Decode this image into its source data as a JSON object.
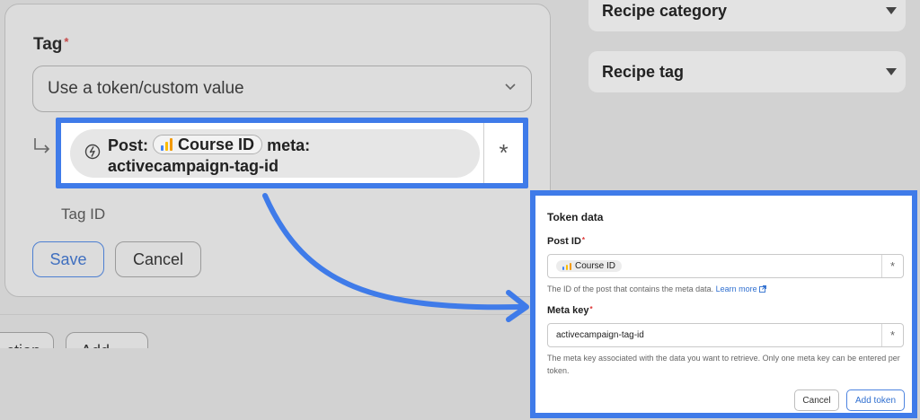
{
  "left_form": {
    "tag_label": "Tag",
    "required_mark": "*",
    "select_value": "Use a token/custom value",
    "token": {
      "prefix": "Post:",
      "chip_label": "Course ID",
      "suffix": "meta:",
      "line2": "activecampaign-tag-id",
      "asterisk": "*"
    },
    "tag_id_label": "Tag ID",
    "save_label": "Save",
    "cancel_label": "Cancel",
    "partial_button_1": "ction",
    "partial_button_2": "Add"
  },
  "sidebar": {
    "recipe_category": "Recipe category",
    "recipe_tag": "Recipe tag"
  },
  "dialog": {
    "title": "Token data",
    "post_id_label": "Post ID",
    "post_id_chip": "Course ID",
    "post_id_help": "The ID of the post that contains the meta data.",
    "learn_more": "Learn more",
    "meta_key_label": "Meta key",
    "meta_key_value": "activecampaign-tag-id",
    "meta_key_help": "The meta key associated with the data you want to retrieve. Only one meta key can be entered per token.",
    "cancel_label": "Cancel",
    "add_token_label": "Add token",
    "asterisk": "*",
    "required_mark": "*"
  },
  "icons": {
    "chevron": "chevron-down-icon",
    "return_arrow": "return-arrow-icon",
    "bolt": "bolt-icon",
    "bars": "bar-chart-icon",
    "external": "external-link-icon"
  },
  "colors": {
    "highlight": "#3f7be9",
    "bar_blue": "#4285f4",
    "bar_yellow": "#fbbc04",
    "bar_orange": "#f29900",
    "link": "#2f6fd0",
    "required": "#c54a4a"
  }
}
